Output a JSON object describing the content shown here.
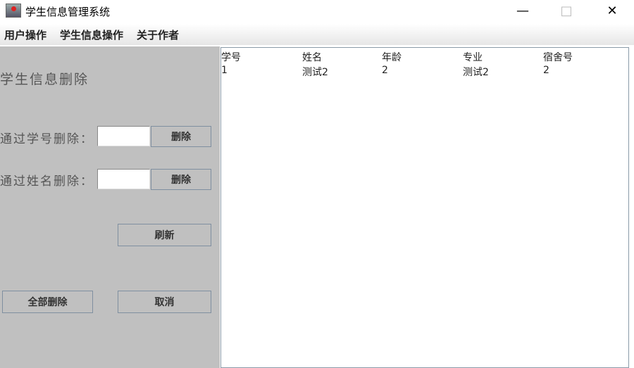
{
  "window": {
    "title": "学生信息管理系统",
    "minimize": "—",
    "maximize": "□",
    "close": "✕"
  },
  "menu": [
    "用户操作",
    "学生信息操作",
    "关于作者"
  ],
  "panel": {
    "heading": "学生信息删除",
    "by_id_label": "通过学号删除：",
    "by_id_value": "",
    "by_id_button": "删除",
    "by_name_label": "通过姓名删除：",
    "by_name_value": "",
    "by_name_button": "删除",
    "refresh": "刷新",
    "delete_all": "全部删除",
    "cancel": "取消"
  },
  "table": {
    "headers": [
      "学号",
      "姓名",
      "年龄",
      "专业",
      "宿舍号"
    ],
    "rows": [
      [
        "1",
        "测试2",
        "2",
        "测试2",
        "2"
      ]
    ]
  }
}
